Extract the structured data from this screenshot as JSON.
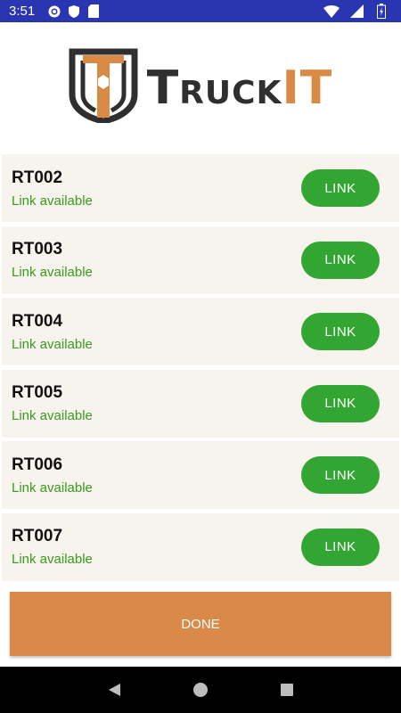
{
  "status_bar": {
    "time": "3:51",
    "icons_left": [
      "gear-icon",
      "shield-icon",
      "sd-card-icon"
    ],
    "icons_right": [
      "wifi-icon",
      "signal-icon",
      "battery-icon"
    ]
  },
  "logo": {
    "part1": "Truck",
    "part2": "IT"
  },
  "items": [
    {
      "title": "RT002",
      "status": "Link available",
      "button": "LINK"
    },
    {
      "title": "RT003",
      "status": "Link available",
      "button": "LINK"
    },
    {
      "title": "RT004",
      "status": "Link available",
      "button": "LINK"
    },
    {
      "title": "RT005",
      "status": "Link available",
      "button": "LINK"
    },
    {
      "title": "RT006",
      "status": "Link available",
      "button": "LINK"
    },
    {
      "title": "RT007",
      "status": "Link available",
      "button": "LINK"
    }
  ],
  "done_label": "DONE",
  "colors": {
    "status_bar": "#2a36b1",
    "accent": "#d98a48",
    "link_button": "#33a532",
    "status_text": "#3a9a1e",
    "item_bg": "#f7f4ee"
  }
}
